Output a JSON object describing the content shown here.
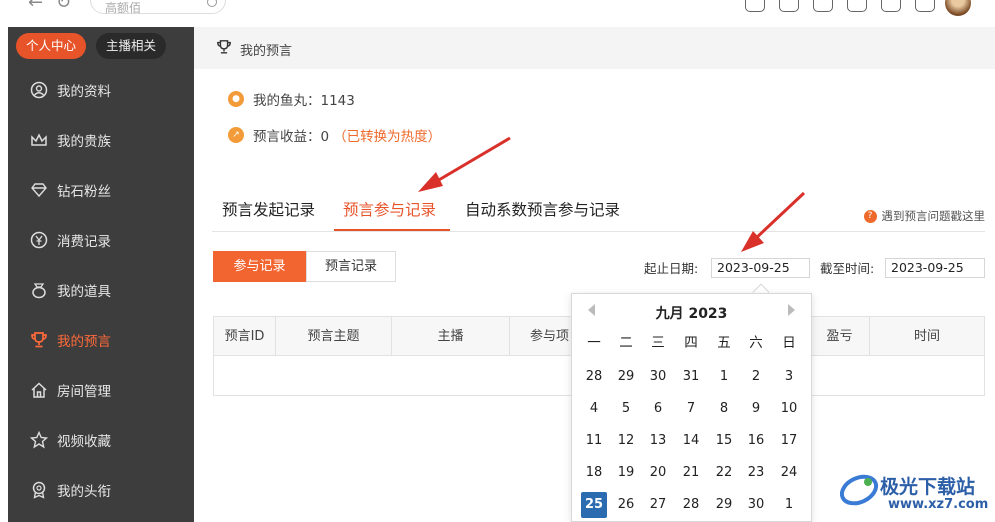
{
  "topbar": {
    "search_placeholder": "高额佰"
  },
  "sidebar": {
    "tabs": [
      {
        "label": "个人中心",
        "active": true
      },
      {
        "label": "主播相关",
        "active": false
      }
    ],
    "items": [
      {
        "label": "我的资料",
        "icon": "user-circle-icon"
      },
      {
        "label": "我的贵族",
        "icon": "crown-icon"
      },
      {
        "label": "钻石粉丝",
        "icon": "diamond-icon"
      },
      {
        "label": "消费记录",
        "icon": "yen-icon"
      },
      {
        "label": "我的道具",
        "icon": "bag-icon"
      },
      {
        "label": "我的预言",
        "icon": "trophy-icon",
        "active": true
      },
      {
        "label": "房间管理",
        "icon": "home-icon"
      },
      {
        "label": "视频收藏",
        "icon": "star-icon"
      },
      {
        "label": "我的头衔",
        "icon": "badge-icon"
      }
    ]
  },
  "header": {
    "title": "我的预言"
  },
  "stats": {
    "fishball_label": "我的鱼丸：1143",
    "income_label": "预言收益：0",
    "income_note": "（已转换为热度）"
  },
  "tabs": [
    {
      "label": "预言发起记录",
      "active": false
    },
    {
      "label": "预言参与记录",
      "active": true
    },
    {
      "label": "自动系数预言参与记录",
      "active": false
    }
  ],
  "help_text": "遇到预言问题戳这里",
  "subtabs": [
    {
      "label": "参与记录",
      "active": true
    },
    {
      "label": "预言记录",
      "active": false
    }
  ],
  "filters": {
    "start_label": "起止日期:",
    "start_value": "2023-09-25",
    "end_label": "截至时间:",
    "end_value": "2023-09-25"
  },
  "table": {
    "columns": [
      "预言ID",
      "预言主题",
      "主播",
      "参与项",
      "",
      "",
      "盈亏",
      "时间"
    ]
  },
  "calendar": {
    "title": "九月 2023",
    "weekdays": [
      "一",
      "二",
      "三",
      "四",
      "五",
      "六",
      "日"
    ],
    "weeks": [
      [
        "28",
        "29",
        "30",
        "31",
        "1",
        "2",
        "3"
      ],
      [
        "4",
        "5",
        "6",
        "7",
        "8",
        "9",
        "10"
      ],
      [
        "11",
        "12",
        "13",
        "14",
        "15",
        "16",
        "17"
      ],
      [
        "18",
        "19",
        "20",
        "21",
        "22",
        "23",
        "24"
      ],
      [
        "25",
        "26",
        "27",
        "28",
        "29",
        "30",
        "1"
      ]
    ],
    "selected": "25"
  },
  "watermark": {
    "name": "极光下载站",
    "url": "www.xz7.com"
  },
  "colors": {
    "accent": "#e8542a",
    "sidebar": "#3d3d3d",
    "selected_day": "#2b6cb0",
    "arrow": "#d9302a"
  }
}
